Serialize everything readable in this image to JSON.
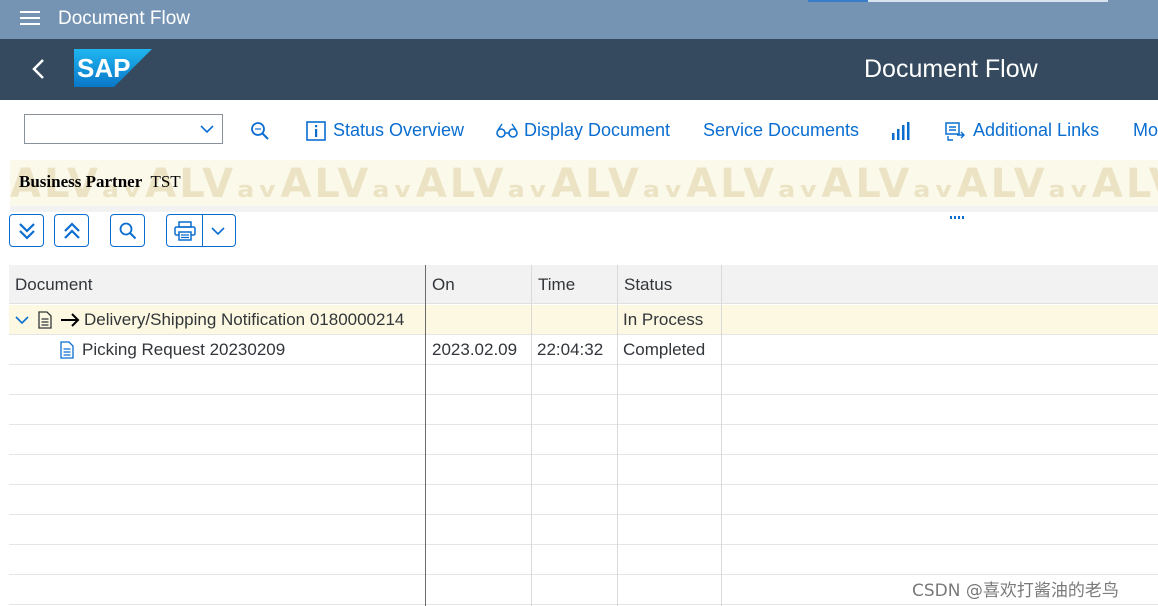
{
  "topbar": {
    "title": "Document Flow"
  },
  "shell": {
    "page_title": "Document Flow",
    "logo_text": "SAP"
  },
  "toolbar": {
    "dropdown_value": "",
    "status_overview": "Status Overview",
    "display_document": "Display Document",
    "service_documents": "Service Documents",
    "additional_links": "Additional Links",
    "more": "Mo"
  },
  "alv": {
    "watermark": "ALVₐᵥALVₐᵥALVₐᵥALVₐᵥALVₐᵥALVₐᵥALVₐᵥALVₐᵥALVₐᵥALVₐ",
    "business_partner_label": "Business Partner",
    "business_partner_value": "TST"
  },
  "table": {
    "columns": [
      "Document",
      "On",
      "Time",
      "Status"
    ],
    "rows": [
      {
        "document": "Delivery/Shipping Notification 0180000214",
        "on": "",
        "time": "",
        "status": "In Process"
      },
      {
        "document": "Picking Request 20230209",
        "on": "2023.02.09",
        "time": "22:04:32",
        "status": "Completed"
      }
    ]
  },
  "watermark_text": "CSDN @喜欢打酱油的老鸟",
  "colors": {
    "shell_bg": "#354a5f",
    "topbar_bg": "#7594b4",
    "link_blue": "#0a6ed1",
    "highlight_row": "#fcf8e1"
  }
}
